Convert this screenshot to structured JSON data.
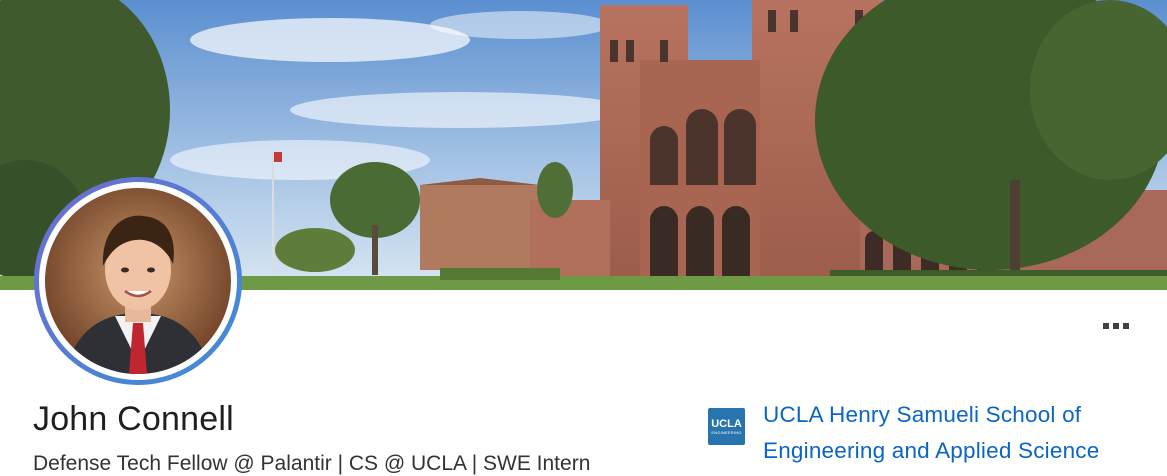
{
  "profile": {
    "name": "John Connell",
    "headline": "Defense Tech Fellow @ Palantir | CS @ UCLA | SWE Intern"
  },
  "education": {
    "school_name": "UCLA Henry Samueli School of Engineering and Applied Science",
    "logo_text": "UCLA",
    "logo_subtext": "ENGINEERING"
  },
  "icons": {
    "more": "more-horizontal-icon"
  },
  "colors": {
    "link": "#0a66c2",
    "logo_bg": "#2774ae",
    "avatar_ring": "#5b7fd4"
  }
}
